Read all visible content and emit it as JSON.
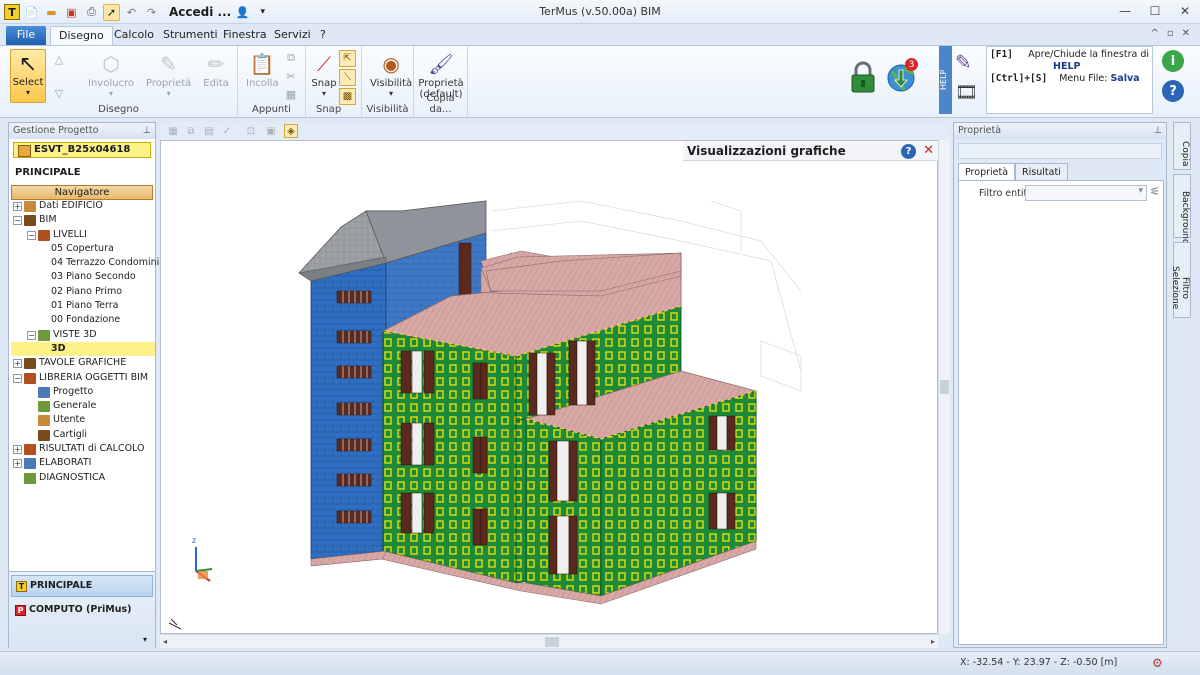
{
  "window": {
    "title": "TerMus (v.50.00a) BIM",
    "account_label": "Accedi ...",
    "minimize_glyph": "—",
    "maximize_glyph": "☐",
    "close_glyph": "✕"
  },
  "ribbon_tabs": [
    {
      "label": "File"
    },
    {
      "label": "Disegno"
    },
    {
      "label": "Calcolo"
    },
    {
      "label": "Strumenti"
    },
    {
      "label": "Finestra"
    },
    {
      "label": "Servizi"
    },
    {
      "label": "?"
    }
  ],
  "ribbon": {
    "select_label": "Select",
    "involucro_label": "Involucro",
    "proprieta_label": "Proprietà",
    "edita_label": "Edita",
    "incolla_label": "Incolla",
    "snap_label": "Snap",
    "visibilita_label": "Visibilità",
    "proprieta_default_label": "Proprietà (default)",
    "group_disegno": "Disegno",
    "group_appunti": "Appunti",
    "group_snap": "Snap",
    "group_visibilita": "Visibilità",
    "group_copia": "Copia da...",
    "notification_count": "3",
    "help_strip": "HELP"
  },
  "help_box": {
    "f1_key": "[F1]",
    "f1_text": "Apre/Chiude la finestra di",
    "f1_bold": "HELP",
    "save_key": "[Ctrl]+[S]",
    "save_text": "Menu File:",
    "save_bold": "Salva"
  },
  "left_panel": {
    "header": "Gestione Progetto",
    "project": "ESVT_B25x04618",
    "section": "PRINCIPALE",
    "navigator_button": "Navigatore",
    "tree": [
      {
        "label": "Dati EDIFICIO",
        "level": 0,
        "expander": "+"
      },
      {
        "label": "BIM",
        "level": 0,
        "expander": "−"
      },
      {
        "label": "LIVELLI",
        "level": 1,
        "expander": "−"
      },
      {
        "label": "05 Copertura",
        "level": 2
      },
      {
        "label": "04 Terrazzo Condominiale",
        "level": 2
      },
      {
        "label": "03 Piano Secondo",
        "level": 2
      },
      {
        "label": "02 Piano Primo",
        "level": 2
      },
      {
        "label": "01 Piano Terra",
        "level": 2
      },
      {
        "label": "00 Fondazione",
        "level": 2
      },
      {
        "label": "VISTE 3D",
        "level": 1,
        "expander": "−"
      },
      {
        "label": "3D",
        "level": 2,
        "selected": true
      },
      {
        "label": "TAVOLE GRAFICHE",
        "level": 0,
        "expander": "+"
      },
      {
        "label": "LIBRERIA OGGETTI BIM",
        "level": 0,
        "expander": "−"
      },
      {
        "label": "Progetto",
        "level": 1
      },
      {
        "label": "Generale",
        "level": 1
      },
      {
        "label": "Utente",
        "level": 1
      },
      {
        "label": "Cartigli",
        "level": 1
      },
      {
        "label": "RISULTATI di CALCOLO",
        "level": 0,
        "expander": "+"
      },
      {
        "label": "ELABORATI",
        "level": 0,
        "expander": "+"
      },
      {
        "label": "DIAGNOSTICA",
        "level": 0
      }
    ],
    "bottom_items": [
      {
        "label": "PRINCIPALE",
        "logo": "T"
      },
      {
        "label": "COMPUTO (PriMus)",
        "logo": "P"
      }
    ]
  },
  "viewport": {
    "panel_title": "Visualizzazioni grafiche",
    "panel_help_glyph": "?",
    "panel_close_glyph": "✕"
  },
  "right_panel": {
    "header": "Proprietà",
    "tabs": [
      "Proprietà",
      "Risultati"
    ],
    "filter_label": "Filtro entità",
    "side_tabs": [
      "Copia",
      "Background",
      "Filtro Selezione"
    ]
  },
  "status": {
    "coords": "X: -32.54 - Y: 23.97 - Z: -0.50 [m]"
  },
  "colors": {
    "green_wall": "#1d8a3a",
    "blue_wall": "#2f6fc4",
    "roof_pink": "#cfa3a0",
    "roof_grey": "#9a9ea3",
    "window_frame": "#f2e400",
    "shutter": "#5a2a1e",
    "selected_yellow": "#fdf18a"
  }
}
